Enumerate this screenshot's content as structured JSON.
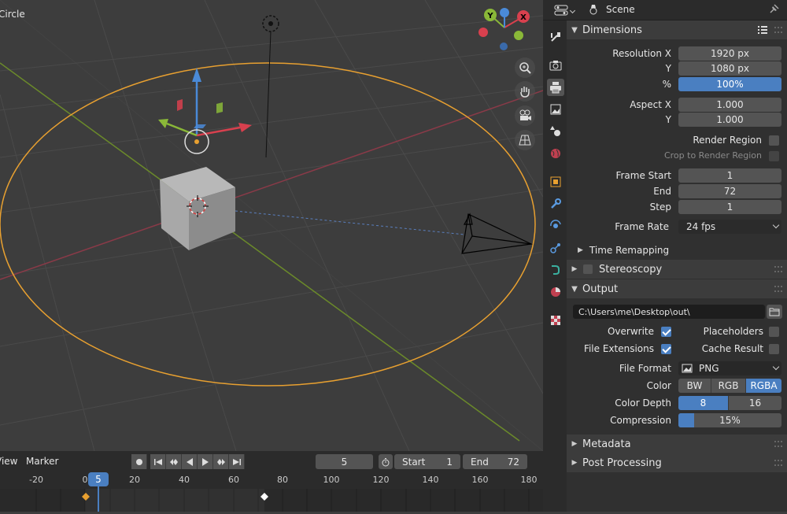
{
  "viewport": {
    "object_label": "Circle",
    "gizmo": {
      "x": "X",
      "y": "Y"
    }
  },
  "timeline": {
    "menu_view": "View",
    "menu_marker": "Marker",
    "current_frame": "5",
    "start_label": "Start",
    "start_value": "1",
    "end_label": "End",
    "end_value": "72",
    "ticks": [
      "-20",
      "0",
      "20",
      "40",
      "60",
      "80",
      "100",
      "120",
      "140",
      "160",
      "180"
    ],
    "cursor_label": "5"
  },
  "properties": {
    "header": {
      "scene_label": "Scene"
    },
    "dimensions": {
      "title": "Dimensions",
      "resolution_x_label": "Resolution X",
      "resolution_x": "1920 px",
      "resolution_y_label": "Y",
      "resolution_y": "1080 px",
      "percent_label": "%",
      "percent": "100%",
      "aspect_x_label": "Aspect X",
      "aspect_x": "1.000",
      "aspect_y_label": "Y",
      "aspect_y": "1.000",
      "render_region_label": "Render Region",
      "crop_label": "Crop to Render Region",
      "frame_start_label": "Frame Start",
      "frame_start": "1",
      "end_label": "End",
      "end": "72",
      "step_label": "Step",
      "step": "1",
      "frame_rate_label": "Frame Rate",
      "frame_rate": "24 fps",
      "time_remapping": "Time Remapping"
    },
    "stereoscopy": {
      "title": "Stereoscopy"
    },
    "output": {
      "title": "Output",
      "path": "C:\\Users\\me\\Desktop\\out\\",
      "overwrite_label": "Overwrite",
      "placeholders_label": "Placeholders",
      "file_extensions_label": "File Extensions",
      "cache_result_label": "Cache Result",
      "file_format_label": "File Format",
      "file_format": "PNG",
      "color_label": "Color",
      "color_options": [
        "BW",
        "RGB",
        "RGBA"
      ],
      "color_depth_label": "Color Depth",
      "color_depth_options": [
        "8",
        "16"
      ],
      "compression_label": "Compression",
      "compression": "15%",
      "compression_fraction": 0.15
    },
    "metadata": {
      "title": "Metadata"
    },
    "post_processing": {
      "title": "Post Processing"
    }
  }
}
